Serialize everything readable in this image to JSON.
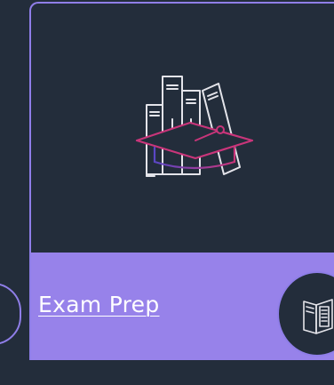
{
  "card": {
    "title": "Exam Prep",
    "hero_icon": "books-graduation-cap-icon",
    "badge_icon": "open-book-icon"
  },
  "colors": {
    "background": "#232d3b",
    "accent_border": "#8f7ee8",
    "footer_fill": "#9782ea",
    "cap_magenta": "#c9357a",
    "cap_gradient_start": "#5a46c4",
    "line_art": "#e4e4ea"
  }
}
